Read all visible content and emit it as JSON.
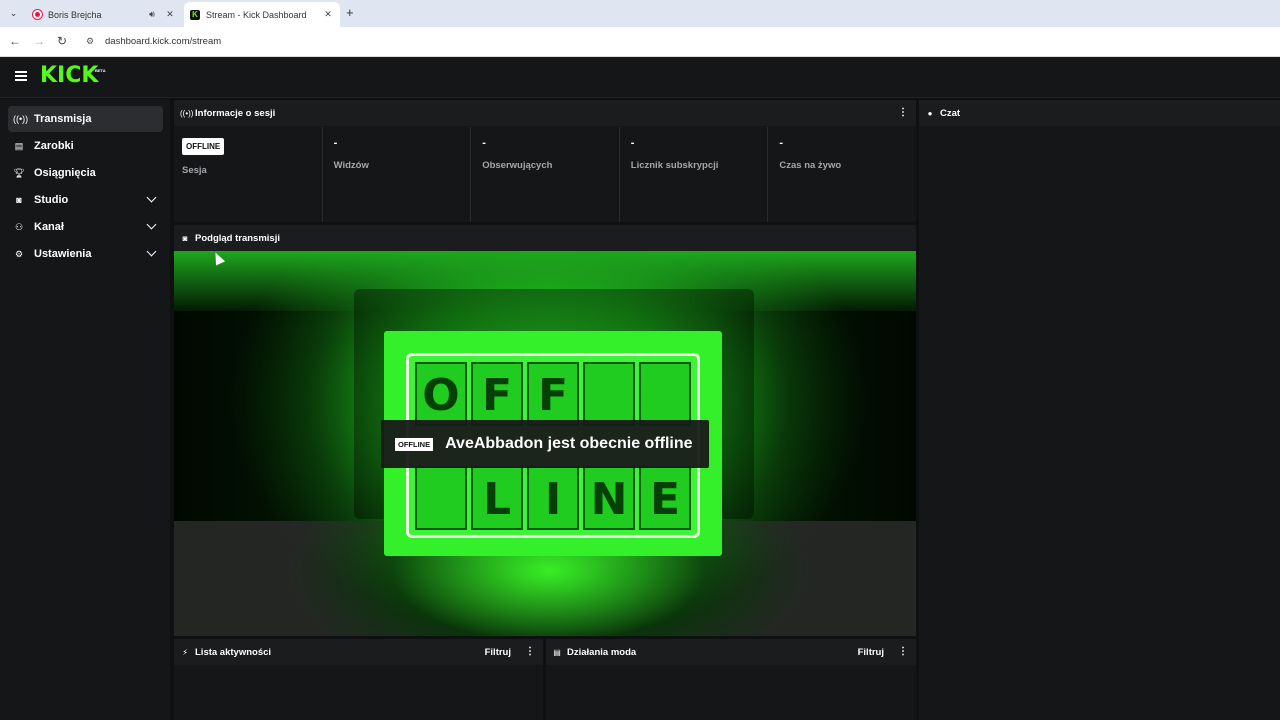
{
  "browser": {
    "tabs": [
      {
        "title": "Boris Brejcha",
        "icon": "speaker-icon"
      },
      {
        "title": "Stream - Kick Dashboard",
        "icon": "close-icon"
      }
    ],
    "new_tab": "+",
    "url": "dashboard.kick.com/stream"
  },
  "app": {
    "logo": "KICK",
    "logo_tag": "BETA"
  },
  "sidebar": {
    "items": [
      {
        "label": "Transmisja",
        "icon": "broadcast-icon",
        "active": true
      },
      {
        "label": "Zarobki",
        "icon": "chart-icon"
      },
      {
        "label": "Osiągnięcia",
        "icon": "trophy-icon"
      },
      {
        "label": "Studio",
        "icon": "studio-icon",
        "expandable": true
      },
      {
        "label": "Kanał",
        "icon": "channel-icon",
        "expandable": true
      },
      {
        "label": "Ustawienia",
        "icon": "gear-icon",
        "expandable": true
      }
    ]
  },
  "session": {
    "title": "Informacje o sesji",
    "badge": "OFFLINE",
    "stats": [
      {
        "label": "Sesja"
      },
      {
        "value": "-",
        "label": "Widzów"
      },
      {
        "value": "-",
        "label": "Obserwujących"
      },
      {
        "value": "-",
        "label": "Licznik subskrypcji"
      },
      {
        "value": "-",
        "label": "Czas na żywo"
      }
    ]
  },
  "preview": {
    "title": "Podgląd transmisji",
    "badge": "OFFLINE",
    "message": "AveAbbadon jest obecnie offline",
    "screen_top": [
      "O",
      "F",
      "F",
      "",
      ""
    ],
    "screen_bottom": [
      "",
      "L",
      "I",
      "N",
      "E"
    ]
  },
  "chat": {
    "title": "Czat"
  },
  "activity": {
    "title": "Lista aktywności",
    "filter": "Filtruj"
  },
  "mod": {
    "title": "Działania moda",
    "filter": "Filtruj"
  },
  "colors": {
    "accent": "#53fc18",
    "bg": "#0f1011",
    "panel": "#151617"
  }
}
